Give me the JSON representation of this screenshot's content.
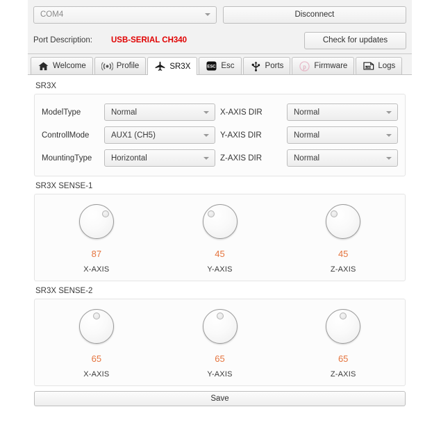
{
  "header": {
    "port_select": {
      "value": "COM4",
      "placeholder": "COM4"
    },
    "disconnect_label": "Disconnect",
    "port_description_label": "Port Description:",
    "port_description_value": "USB-SERIAL CH340",
    "check_updates_label": "Check for updates",
    "port_description_color": "#e00000"
  },
  "tabs": [
    {
      "label": "Welcome",
      "icon": "home-icon",
      "active": false
    },
    {
      "label": "Profile",
      "icon": "broadcast-icon",
      "active": false
    },
    {
      "label": "SR3X",
      "icon": "airplane-icon",
      "active": true
    },
    {
      "label": "Esc",
      "icon": "esc-icon",
      "active": false
    },
    {
      "label": "Ports",
      "icon": "usb-icon",
      "active": false
    },
    {
      "label": "Firmware",
      "icon": "firmware-icon",
      "active": false
    },
    {
      "label": "Logs",
      "icon": "log-file-icon",
      "active": false
    }
  ],
  "sr3x": {
    "group_label": "SR3X",
    "rows": [
      {
        "left_label": "ModelType",
        "left_value": "Normal",
        "right_label": "X-AXIS DIR",
        "right_value": "Normal"
      },
      {
        "left_label": "ControllMode",
        "left_value": "AUX1 (CH5)",
        "right_label": "Y-AXIS DIR",
        "right_value": "Normal"
      },
      {
        "left_label": "MountingType",
        "left_value": "Horizontal",
        "right_label": "Z-AXIS DIR",
        "right_value": "Normal"
      }
    ]
  },
  "sense1": {
    "group_label": "SR3X SENSE-1",
    "knobs": [
      {
        "label": "X-AXIS",
        "value": "87",
        "dot": "dot-upper-right"
      },
      {
        "label": "Y-AXIS",
        "value": "45",
        "dot": "dot-upper-left"
      },
      {
        "label": "Z-AXIS",
        "value": "45",
        "dot": "dot-upper-left"
      }
    ]
  },
  "sense2": {
    "group_label": "SR3X SENSE-2",
    "knobs": [
      {
        "label": "X-AXIS",
        "value": "65",
        "dot": "dot-top"
      },
      {
        "label": "Y-AXIS",
        "value": "65",
        "dot": "dot-top"
      },
      {
        "label": "Z-AXIS",
        "value": "65",
        "dot": "dot-top"
      }
    ]
  },
  "footer": {
    "save_label": "Save"
  },
  "colors": {
    "value_orange": "#e5753f",
    "alert_red": "#e00000"
  }
}
